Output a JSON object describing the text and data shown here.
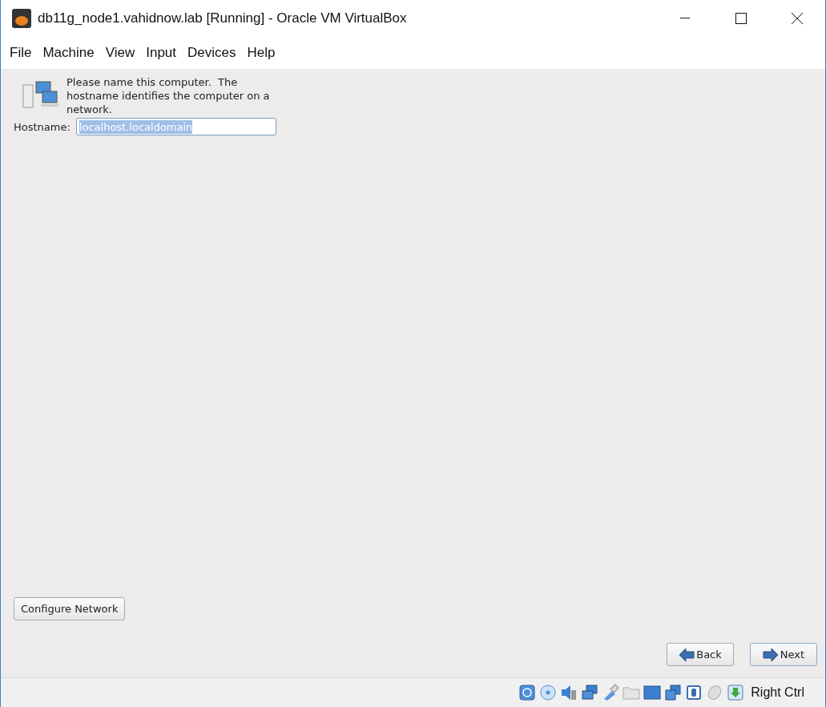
{
  "window": {
    "title": "db11g_node1.vahidnow.lab [Running] - Oracle VM VirtualBox"
  },
  "menu": [
    "File",
    "Machine",
    "View",
    "Input",
    "Devices",
    "Help"
  ],
  "intro": "Please name this computer.  The hostname identifies the computer on a network.",
  "hostname": {
    "label": "Hostname:",
    "value": "localhost.localdomain"
  },
  "configure_button": "Configure Network",
  "nav_buttons": [
    {
      "kind": "back",
      "label": "Back"
    },
    {
      "kind": "next",
      "label": "Next"
    }
  ],
  "status_bar": {
    "icons": [
      {
        "kind": "disk"
      },
      {
        "kind": "optical"
      },
      {
        "kind": "audio"
      },
      {
        "kind": "network"
      },
      {
        "kind": "usb"
      },
      {
        "kind": "folder"
      },
      {
        "kind": "display"
      },
      {
        "kind": "recording"
      },
      {
        "kind": "cpu"
      },
      {
        "kind": "mouse"
      },
      {
        "kind": "keyboard"
      }
    ],
    "host_key": "Right Ctrl"
  }
}
